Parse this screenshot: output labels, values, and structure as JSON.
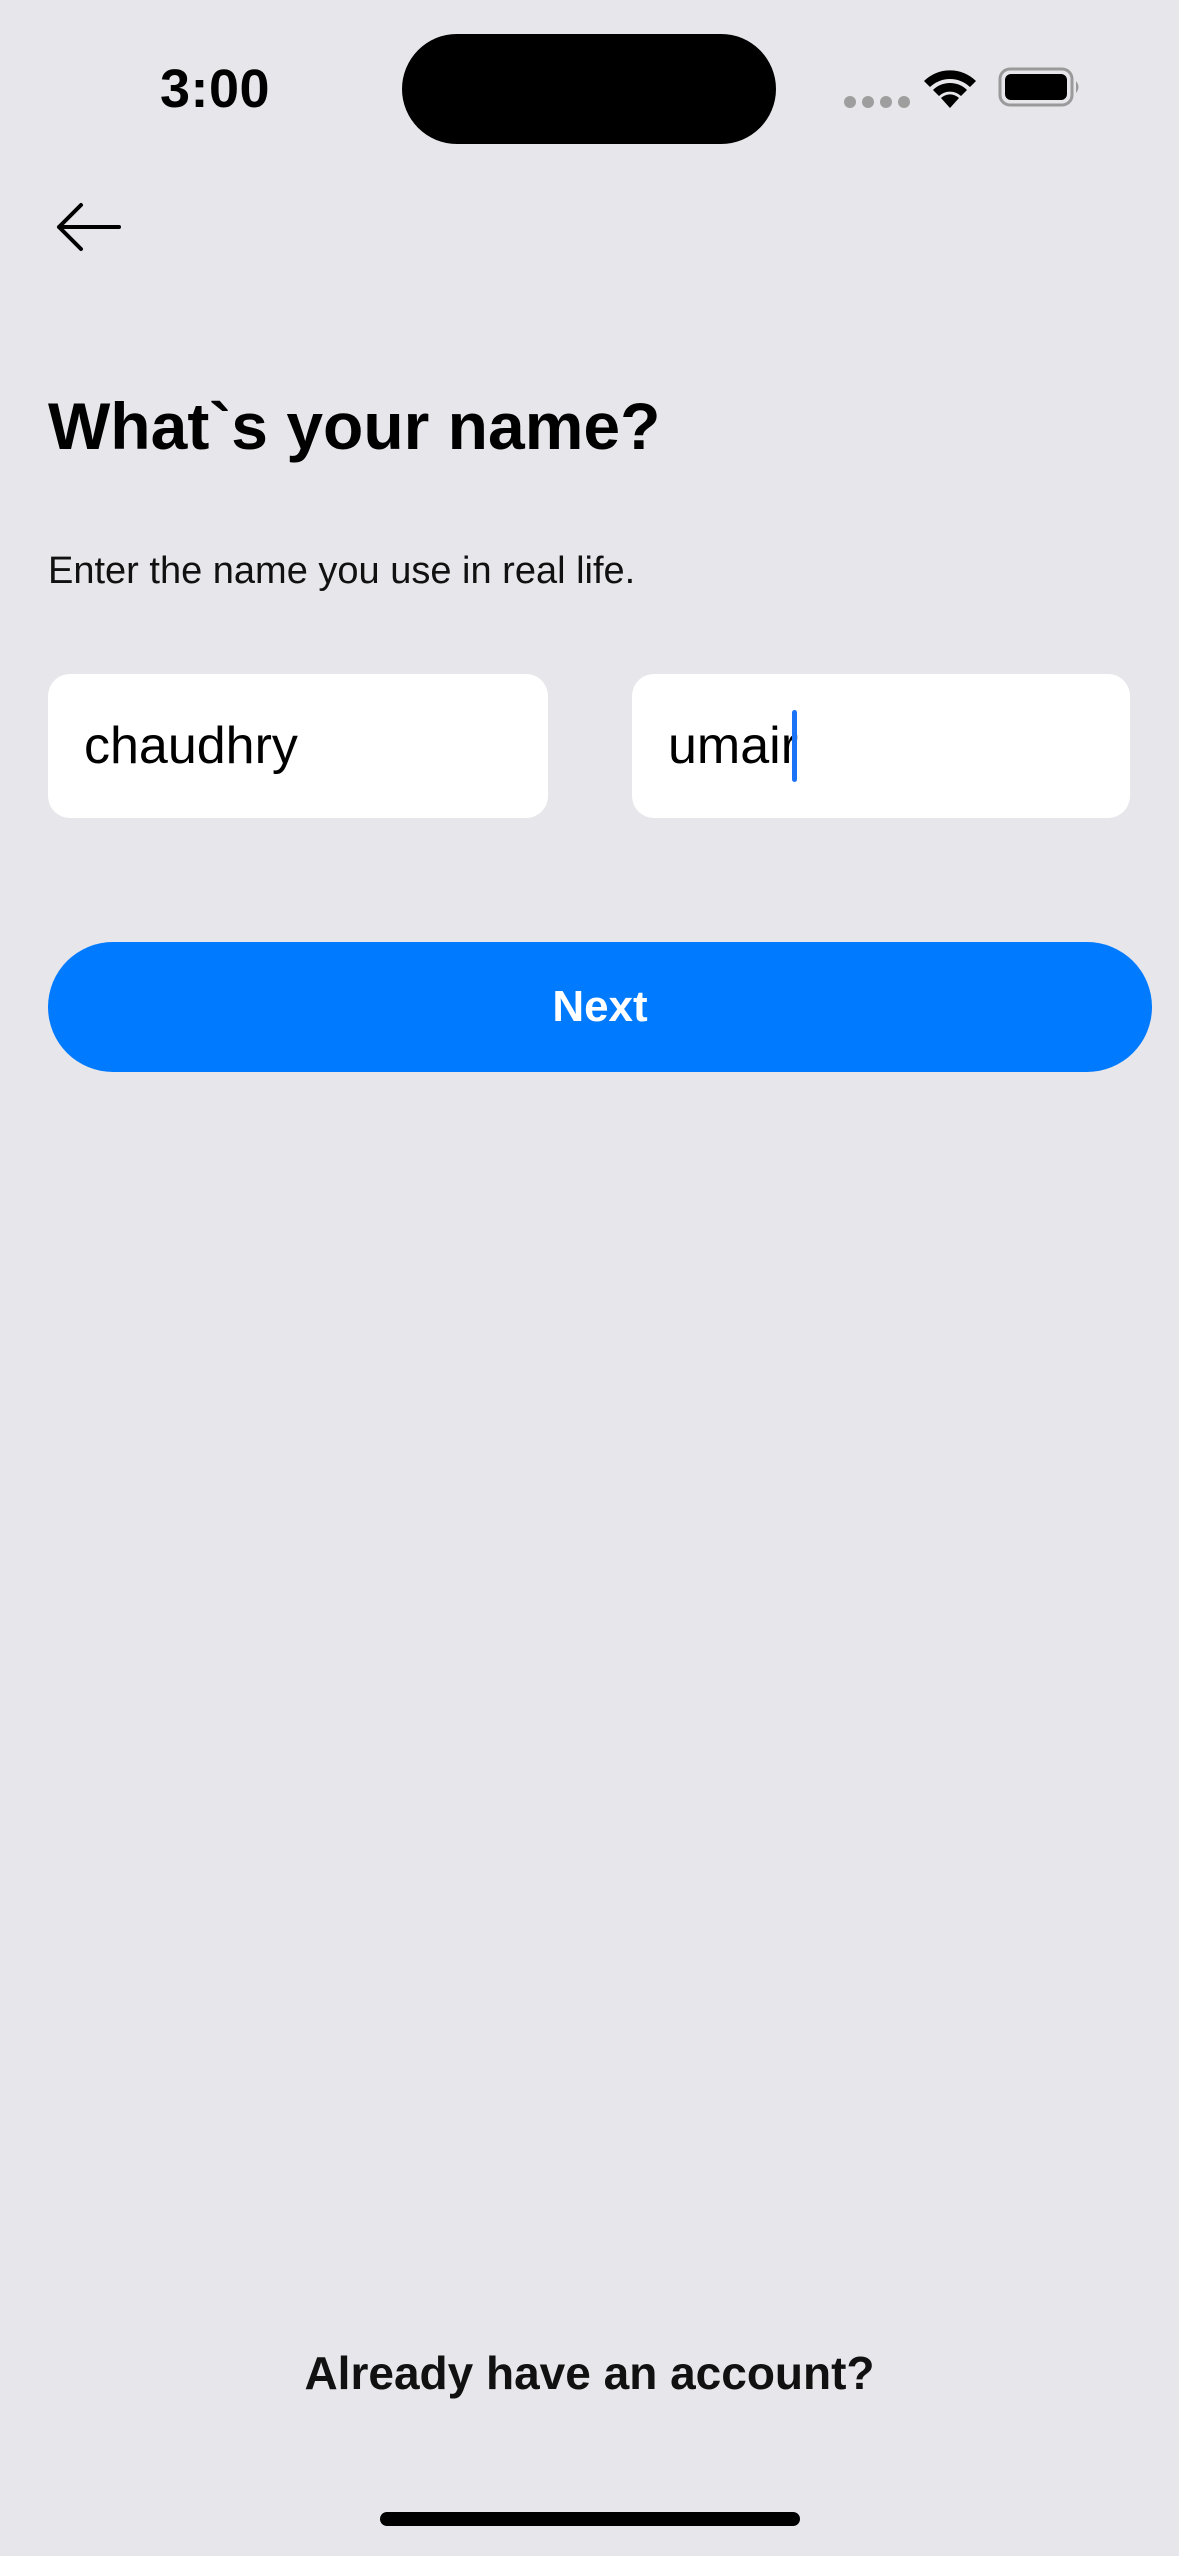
{
  "status_bar": {
    "time": "3:00",
    "icons": [
      "signal-dots-icon",
      "wifi-icon",
      "battery-icon"
    ]
  },
  "nav": {
    "back_icon": "arrow-left-icon"
  },
  "form": {
    "title": "What`s your name?",
    "subtitle": "Enter the name you use in real life.",
    "first_name_value": "chaudhry",
    "last_name_value": "umair",
    "next_label": "Next"
  },
  "footer": {
    "account_link": "Already have an account?"
  },
  "colors": {
    "background": "#e6e6eb",
    "accent": "#007aff",
    "input_bg": "#ffffff",
    "cursor": "#1b74f5"
  }
}
